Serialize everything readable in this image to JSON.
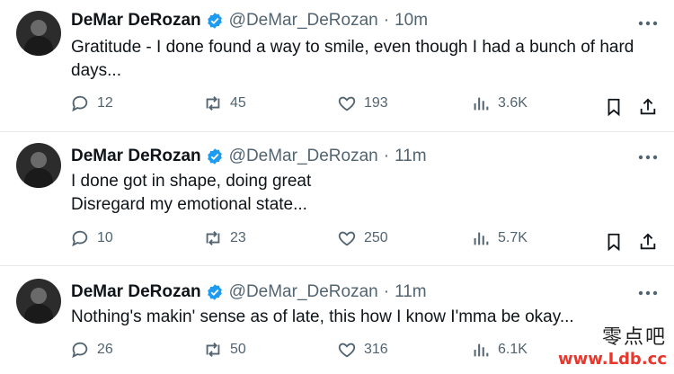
{
  "tweets": [
    {
      "name": "DeMar DeRozan",
      "handle": "@DeMar_DeRozan",
      "dot": "·",
      "time": "10m",
      "lines": [
        "Gratitude - I done found a way to smile, even though I had a bunch of hard",
        "days..."
      ],
      "replies": "12",
      "retweets": "45",
      "likes": "193",
      "views": "3.6K"
    },
    {
      "name": "DeMar DeRozan",
      "handle": "@DeMar_DeRozan",
      "dot": "·",
      "time": "11m",
      "lines": [
        "I done got in shape, doing great",
        "Disregard my emotional state..."
      ],
      "replies": "10",
      "retweets": "23",
      "likes": "250",
      "views": "5.7K"
    },
    {
      "name": "DeMar DeRozan",
      "handle": "@DeMar_DeRozan",
      "dot": "·",
      "time": "11m",
      "lines": [
        "Nothing's makin' sense as of late, this how I know I'mma be okay..."
      ],
      "replies": "26",
      "retweets": "50",
      "likes": "316",
      "views": "6.1K"
    }
  ],
  "icons": {
    "verified": "verified-badge-icon",
    "more": "more-horizontal-icon",
    "reply": "reply-icon",
    "retweet": "retweet-icon",
    "like": "heart-icon",
    "views": "views-chart-icon",
    "bookmark": "bookmark-icon",
    "share": "share-icon"
  },
  "colors": {
    "verified": "#1d9bf0",
    "text": "#0f1419",
    "muted": "#536471",
    "watermark": "#e8372c"
  },
  "watermark": {
    "top": "零点吧",
    "bottom": "www.Ldb.cc"
  }
}
